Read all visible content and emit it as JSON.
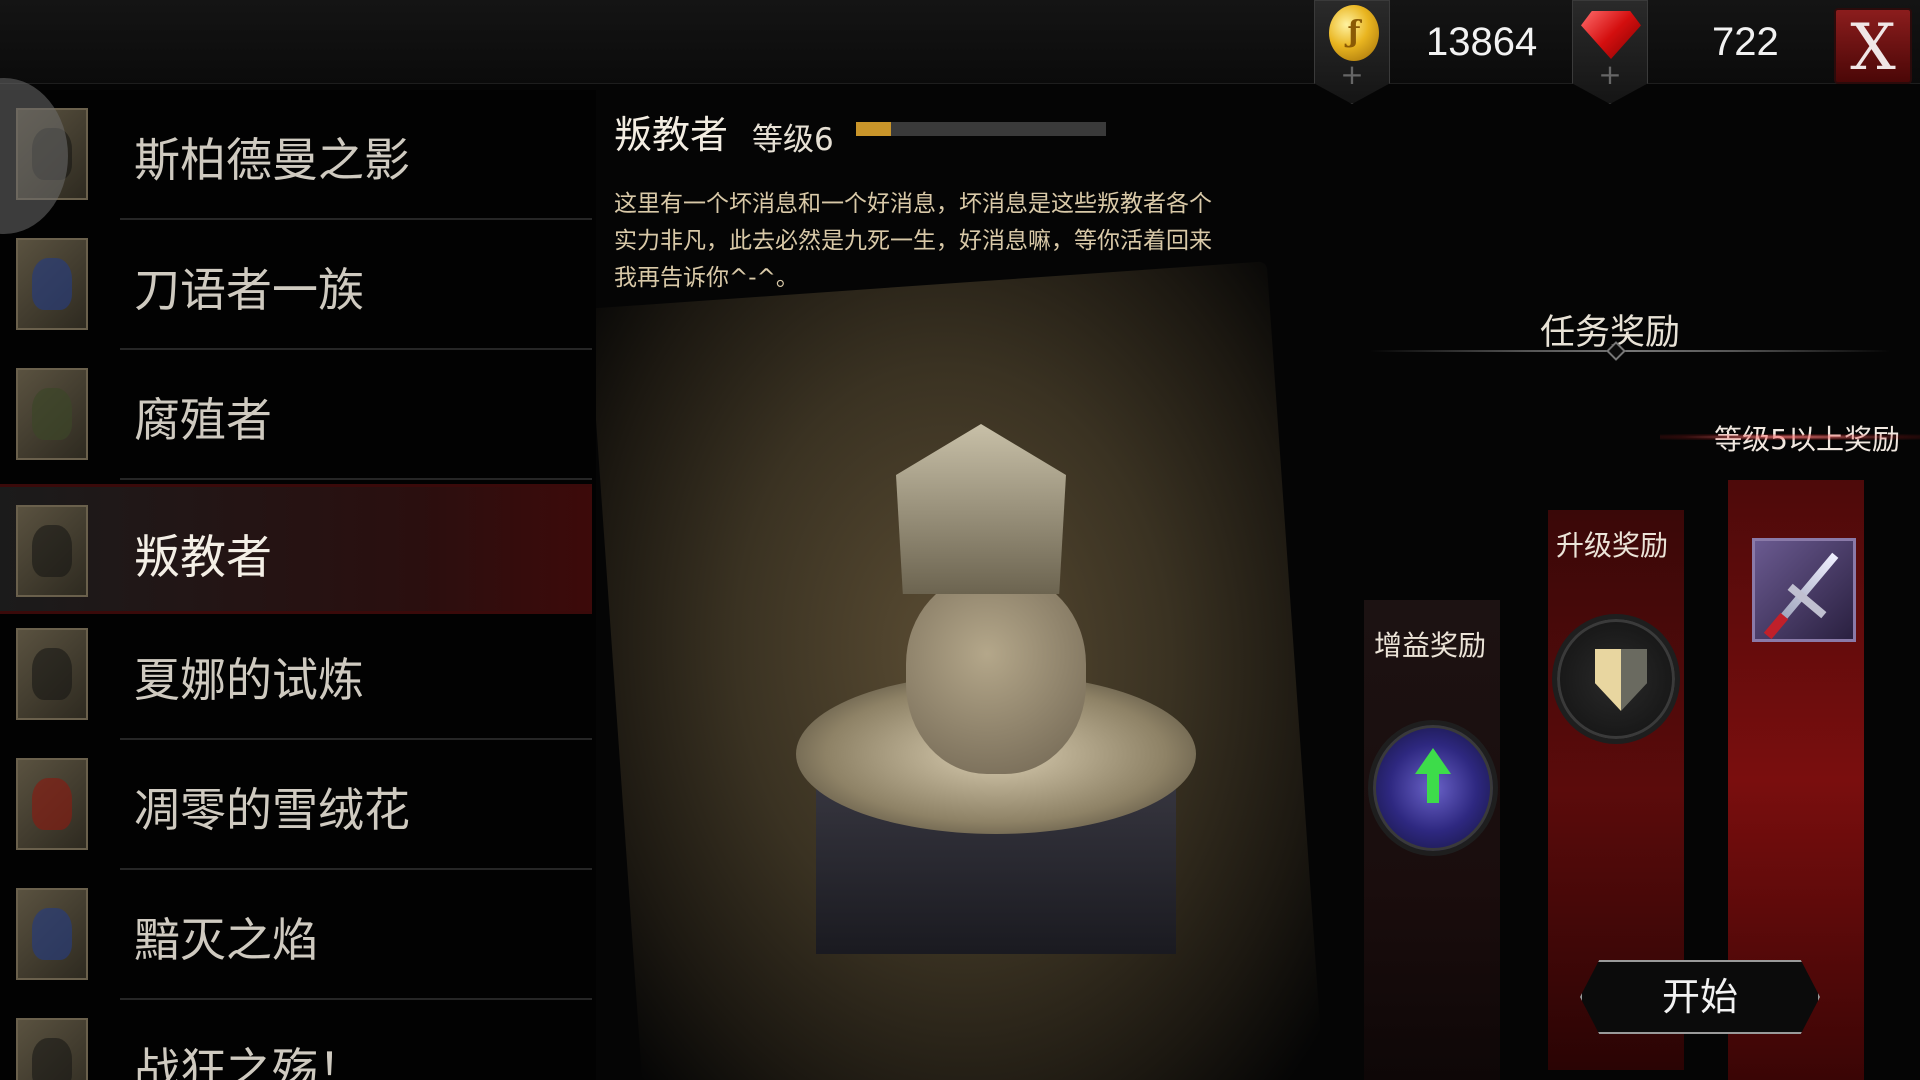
{
  "currency": {
    "gold": "13864",
    "gold_icon": "gold-coin-icon",
    "gems": "722",
    "gem_icon": "red-gem-icon",
    "add_symbol": "+"
  },
  "close_label": "X",
  "missions": [
    {
      "label": "斯柏德曼之影",
      "selected": false
    },
    {
      "label": "刀语者一族",
      "selected": false
    },
    {
      "label": "腐殖者",
      "selected": false
    },
    {
      "label": "叛教者",
      "selected": true
    },
    {
      "label": "夏娜的试炼",
      "selected": false
    },
    {
      "label": "凋零的雪绒花",
      "selected": false
    },
    {
      "label": "黯灭之焰",
      "selected": false
    },
    {
      "label": "战狂之殇！",
      "selected": false
    }
  ],
  "detail": {
    "title": "叛教者",
    "level": "等级6",
    "progress": 0.14,
    "description": "这里有一个坏消息和一个好消息，坏消息是这些叛教者各个实力非凡，此去必然是九死一生，好消息嘛，等你活着回来我再告诉你^-^。"
  },
  "rewards": {
    "title": "任务奖励",
    "bonus_label": "等级5以上奖励",
    "buff_label": "增益奖励",
    "upgrade_label": "升级奖励",
    "buff_icon": "buff-upgrade-icon",
    "upgrade_icon": "shield-upgrade-icon",
    "bonus_icon": "sword-icon"
  },
  "start_label": "开始",
  "colors": {
    "accent_red": "#7a0e0e",
    "progress_fill": "#c9952a"
  }
}
